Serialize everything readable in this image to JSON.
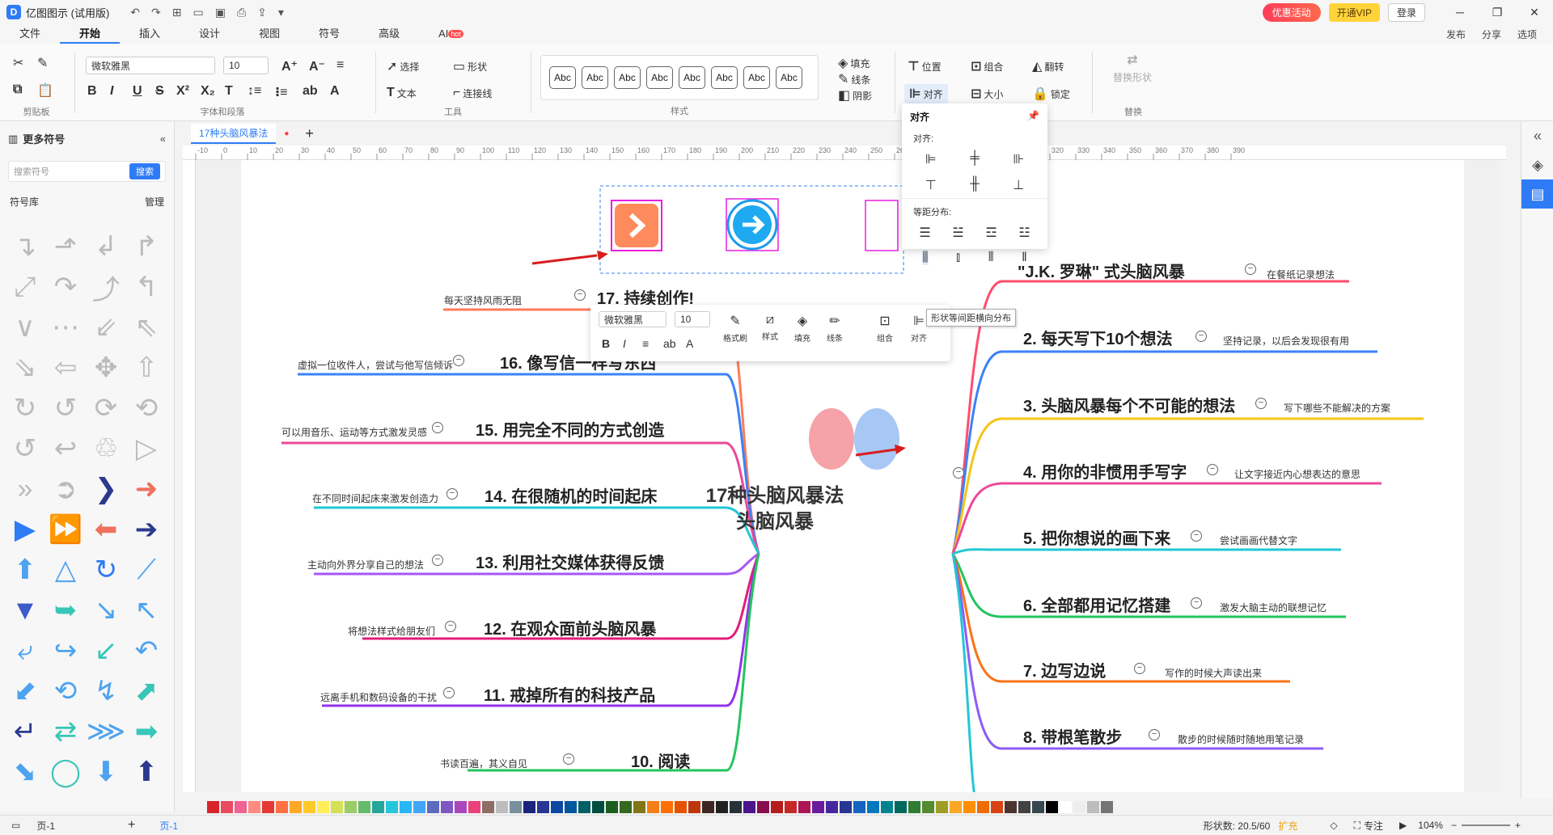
{
  "app": {
    "title": "亿图图示 (试用版)",
    "promo": "优惠活动",
    "vip": "开通VIP",
    "login": "登录"
  },
  "menus": [
    "文件",
    "开始",
    "插入",
    "设计",
    "视图",
    "符号",
    "高级",
    "AI"
  ],
  "menu_hot": "hot",
  "menu_right": [
    "发布",
    "分享",
    "选项"
  ],
  "ribbon": {
    "clipboard_label": "剪贴板",
    "font_name": "微软雅黑",
    "font_size": "10",
    "font_label": "字体和段落",
    "select": "选择",
    "shape": "形状",
    "text": "文本",
    "connector": "连接线",
    "tools_label": "工具",
    "style_sample": "Abc",
    "style_label": "样式",
    "fill": "填充",
    "line": "线条",
    "shadow": "阴影",
    "position": "位置",
    "group": "组合",
    "flip": "翻转",
    "align": "对齐",
    "size": "大小",
    "lock": "锁定",
    "replace_shape": "替换形状",
    "replace_label": "替换"
  },
  "doc_tab": "17种头脑风暴法",
  "left_panel": {
    "title": "更多符号",
    "search_placeholder": "搜索符号",
    "search_btn": "搜索",
    "lib": "符号库",
    "manage": "管理"
  },
  "ruler_ticks": [
    "-10",
    "0",
    "10",
    "20",
    "30",
    "40",
    "50",
    "60",
    "70",
    "80",
    "90",
    "100",
    "110",
    "120",
    "130",
    "140",
    "150",
    "160",
    "170",
    "180",
    "190",
    "200",
    "210",
    "220",
    "230",
    "240",
    "250",
    "260",
    "270",
    "280",
    "290",
    "300",
    "310",
    "320",
    "330",
    "340",
    "350",
    "360",
    "370",
    "380",
    "390"
  ],
  "mindmap": {
    "center": "17种头脑风暴法\n头脑风暴",
    "left": [
      {
        "title": "17. 持续创作!",
        "sub": "每天坚持风雨无阻"
      },
      {
        "title": "16. 像写信一样写东西",
        "sub": "虚拟一位收件人，尝试与他写信倾诉"
      },
      {
        "title": "15. 用完全不同的方式创造",
        "sub": "可以用音乐、运动等方式激发灵感"
      },
      {
        "title": "14. 在很随机的时间起床",
        "sub": "在不同时间起床来激发创造力"
      },
      {
        "title": "13. 利用社交媒体获得反馈",
        "sub": "主动向外界分享自己的想法"
      },
      {
        "title": "12. 在观众面前头脑风暴",
        "sub": "将想法样式给朋友们"
      },
      {
        "title": "11. 戒掉所有的科技产品",
        "sub": "远离手机和数码设备的干扰"
      },
      {
        "title": "10. 阅读",
        "sub": "书读百遍，其义自见"
      }
    ],
    "right": [
      {
        "title": "\"J.K. 罗琳\" 式头脑风暴",
        "sub": "在餐纸记录想法"
      },
      {
        "title": "2. 每天写下10个想法",
        "sub": "坚持记录，以后会发现很有用"
      },
      {
        "title": "3. 头脑风暴每个不可能的想法",
        "sub": "写下哪些不能解决的方案"
      },
      {
        "title": "4. 用你的非惯用手写字",
        "sub": "让文字接近内心想表达的意思"
      },
      {
        "title": "5. 把你想说的画下来",
        "sub": "尝试画画代替文字"
      },
      {
        "title": "6. 全部都用记忆搭建",
        "sub": "激发大脑主动的联想记忆"
      },
      {
        "title": "7. 边写边说",
        "sub": "写作的时候大声读出来"
      },
      {
        "title": "8. 带根笔散步",
        "sub": "散步的时候随时随地用笔记录"
      }
    ]
  },
  "mini_toolbar": {
    "font": "微软雅黑",
    "size": "10",
    "items": [
      "格式刷",
      "样式",
      "填充",
      "线条",
      "组合",
      "对齐"
    ]
  },
  "align_dropdown": {
    "title": "对齐",
    "align_label": "对齐:",
    "dist_label": "等距分布:",
    "tooltip": "形状等间距横向分布"
  },
  "palette": [
    "#d8232a",
    "#e84a5f",
    "#f06292",
    "#ff8a80",
    "#e53935",
    "#ff7043",
    "#ffa726",
    "#ffca28",
    "#ffee58",
    "#d4e157",
    "#9ccc65",
    "#66bb6a",
    "#26a69a",
    "#26c6da",
    "#29b6f6",
    "#42a5f5",
    "#5c6bc0",
    "#7e57c2",
    "#ab47bc",
    "#ec407a",
    "#8d6e63",
    "#bdbdbd",
    "#78909c",
    "#1a237e",
    "#283593",
    "#0d47a1",
    "#01579b",
    "#006064",
    "#004d40",
    "#1b5e20",
    "#33691e",
    "#827717",
    "#f57f17",
    "#ff6f00",
    "#e65100",
    "#bf360c",
    "#3e2723",
    "#212121",
    "#263238",
    "#4a148c",
    "#880e4f",
    "#b71c1c",
    "#c62828",
    "#ad1457",
    "#6a1b9a",
    "#4527a0",
    "#283593",
    "#1565c0",
    "#0277bd",
    "#00838f",
    "#00695c",
    "#2e7d32",
    "#558b2f",
    "#9e9d24",
    "#f9a825",
    "#ff8f00",
    "#ef6c00",
    "#d84315",
    "#4e342e",
    "#424242",
    "#37474f",
    "#000000",
    "#ffffff",
    "#eeeeee",
    "#bdbdbd",
    "#757575"
  ],
  "status": {
    "page_label": "页-1",
    "page_tab": "页-1",
    "shapes": "形状数: 20.5/60",
    "expand": "扩充",
    "focus": "专注",
    "zoom": "104%"
  }
}
